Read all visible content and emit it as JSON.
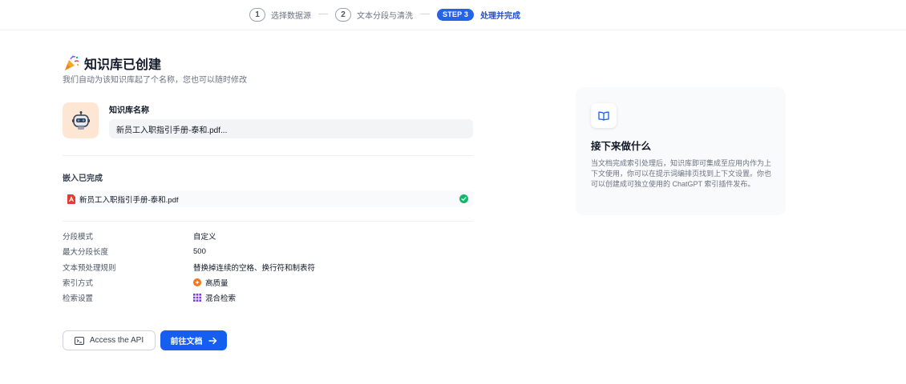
{
  "stepper": {
    "steps": [
      {
        "num": "1",
        "label": "选择数据源"
      },
      {
        "num": "2",
        "label": "文本分段与清洗"
      },
      {
        "num": "STEP 3",
        "label": "处理并完成"
      }
    ]
  },
  "header": {
    "title": "知识库已创建",
    "subtitle": "我们自动为该知识库起了个名称，您也可以随时修改"
  },
  "name_card": {
    "label": "知识库名称",
    "value": "新员工入职指引手册-泰和.pdf..."
  },
  "embedding": {
    "title": "嵌入已完成",
    "file_name": "新员工入职指引手册-泰和.pdf"
  },
  "settings": [
    {
      "key": "分段模式",
      "value": "自定义"
    },
    {
      "key": "最大分段长度",
      "value": "500"
    },
    {
      "key": "文本预处理规则",
      "value": "替换掉连续的空格、换行符和制表符"
    },
    {
      "key": "索引方式",
      "value": "高质量",
      "icon": "sparkle-icon"
    },
    {
      "key": "检索设置",
      "value": "混合检索",
      "icon": "grid-icon"
    }
  ],
  "buttons": {
    "api_label": "Access the API",
    "docs_label": "前往文档"
  },
  "info_card": {
    "title": "接下来做什么",
    "body": "当文档完成索引处理后，知识库即可集成至应用内作为上下文使用，你可以在提示词编排页找到上下文设置。你也可以创建成可独立使用的 ChatGPT 索引插件发布。"
  },
  "colors": {
    "accent": "#155eef",
    "success": "#12b76a",
    "pdf_red": "#e53935",
    "avatar_bg": "#fde7d4"
  }
}
